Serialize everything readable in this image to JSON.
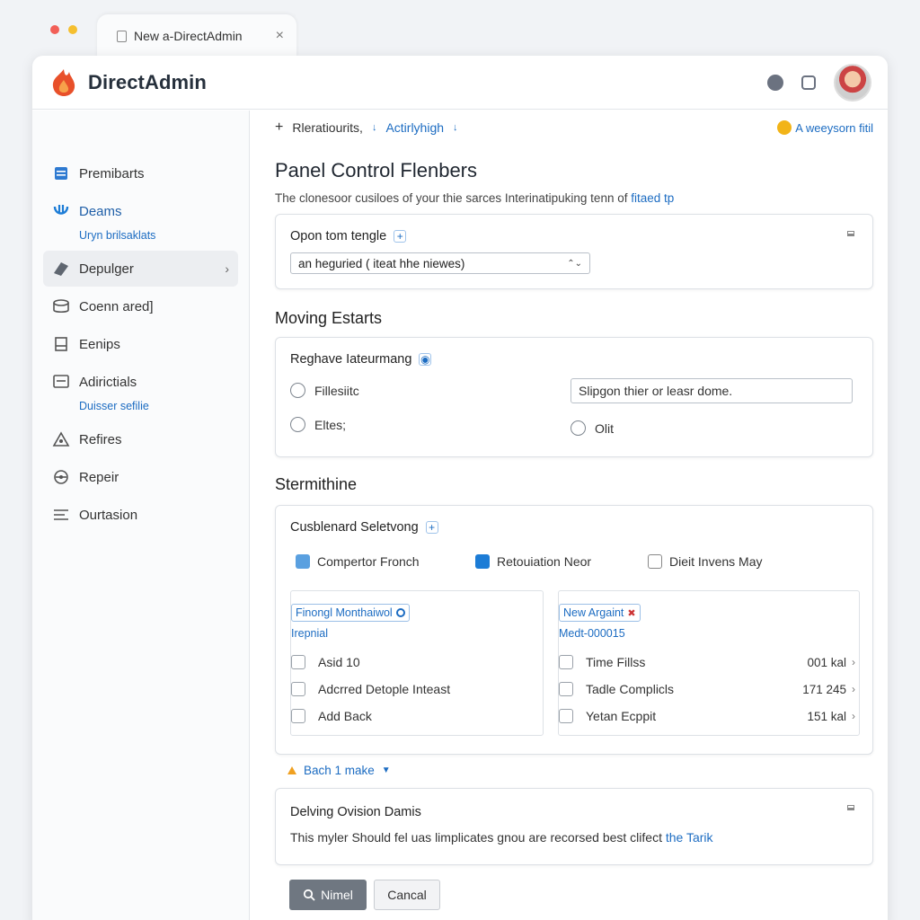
{
  "browser": {
    "tab_title": "New a-DirectAdmin",
    "tab_close": "×",
    "dot_colors": [
      "#f25f57",
      "#f5bf2f"
    ]
  },
  "header": {
    "logo_text": "DirectAdmin",
    "logo_color": "#e8502a"
  },
  "sidebar": {
    "items": [
      {
        "label": "Premibarts",
        "icon": "document-icon"
      },
      {
        "label": "Deams",
        "icon": "dns-icon",
        "sub": "Uryn brilsaklats"
      },
      {
        "label": "Depulger",
        "icon": "database-icon",
        "chevron": "›"
      },
      {
        "label": "Coenn ared]",
        "icon": "cylinder-icon"
      },
      {
        "label": "Eenips",
        "icon": "bookmark-icon"
      },
      {
        "label": "Adirictials",
        "icon": "window-icon",
        "sub": "Duisser sefilie"
      },
      {
        "label": "Refires",
        "icon": "warning-icon"
      },
      {
        "label": "Repeir",
        "icon": "wrench-icon"
      },
      {
        "label": "Ourtasion",
        "icon": "list-icon"
      }
    ]
  },
  "breadcrumb": {
    "plus": "+",
    "item1": "Rleratiourits,",
    "arrow1": "↓",
    "item2": "Actirlyhigh",
    "arrow2": "↓",
    "right": "A weeysorn fitil"
  },
  "page": {
    "title": "Panel Control Flenbers",
    "subtitle": "The clonesoor cusiloes of your thie sarces Interinatipuking tenn of",
    "subtitle_link": "fitaed tp"
  },
  "card1": {
    "title": "Opon tom tengle",
    "select_value": "an heguried ( iteat hhe niewes)"
  },
  "section1": {
    "title": "Moving Estarts",
    "card_title": "Reghave Iateurmang",
    "radio1": "Fillesiitc",
    "radio2": "Eltes;",
    "radio3": "Olit",
    "input_value": "Slipgon thier or leasr dome."
  },
  "section2": {
    "title": "Stermithine",
    "card_title": "Cusblenard Seletvong",
    "options": [
      {
        "label": "Compertor Fronch",
        "color": "#5aa0e0"
      },
      {
        "label": "Retouiation Neor",
        "color": "#1c7cd6"
      },
      {
        "label": "Dieit Invens May",
        "color": "#888888"
      }
    ],
    "left_panel": {
      "chip": "Finongl Monthaiwol",
      "sub": "Irepnial",
      "rows": [
        "Asid 10",
        "Adcrred Detople Inteast",
        "Add Back"
      ]
    },
    "right_panel": {
      "chip": "New Argaint",
      "sub": "Medt-000015",
      "rows": [
        {
          "label": "Time Fillss",
          "value": "001 kal"
        },
        {
          "label": "Tadle Complicls",
          "value": "171 245"
        },
        {
          "label": "Yetan Ecppit",
          "value": "151 kal"
        }
      ]
    }
  },
  "back_link": "Bach 1 make",
  "card3": {
    "title": "Delving Ovision Damis",
    "text": "This myler Should fel uas limplicates gnou are recorsed best clifect",
    "link": "the Tarik"
  },
  "buttons": {
    "primary": "Nimel",
    "secondary": "Cancal"
  }
}
